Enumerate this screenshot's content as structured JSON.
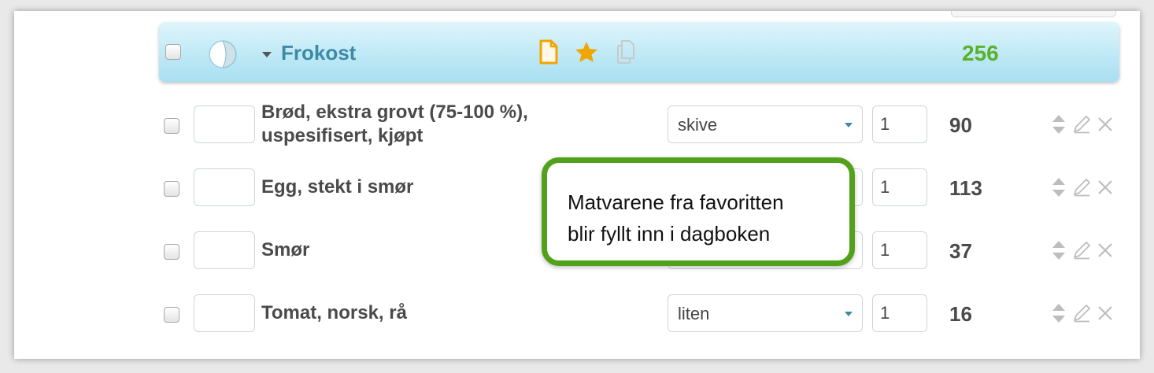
{
  "meal": {
    "title": "Frokost",
    "total_kcal": "256"
  },
  "rows": [
    {
      "name_line1": "Brød, ekstra grovt (75-100 %),",
      "name_line2": "uspesifisert, kjøpt",
      "unit": "skive",
      "quantity": "1",
      "kcal": "90"
    },
    {
      "name_line1": "Egg, stekt i smør",
      "name_line2": "",
      "unit": "",
      "quantity": "1",
      "kcal": "113"
    },
    {
      "name_line1": "Smør",
      "name_line2": "",
      "unit": "",
      "quantity": "1",
      "kcal": "37"
    },
    {
      "name_line1": "Tomat, norsk, rå",
      "name_line2": "",
      "unit": "liten",
      "quantity": "1",
      "kcal": "16"
    }
  ],
  "callout": {
    "line1": "Matvarene fra favoritten",
    "line2": "blir fyllt inn i dagboken"
  },
  "icons": {
    "meal": [
      "pie-chart-icon",
      "caret-down-icon",
      "document-icon",
      "star-icon",
      "copy-icon"
    ],
    "row_actions": [
      "sort-icon",
      "pencil-icon",
      "close-icon"
    ]
  },
  "colors": {
    "meal_title": "#3d8aa5",
    "total_kcal": "#59b22a",
    "callout_border": "#52a11b",
    "document_icon": "#f0a500",
    "star_icon": "#f0a500"
  }
}
